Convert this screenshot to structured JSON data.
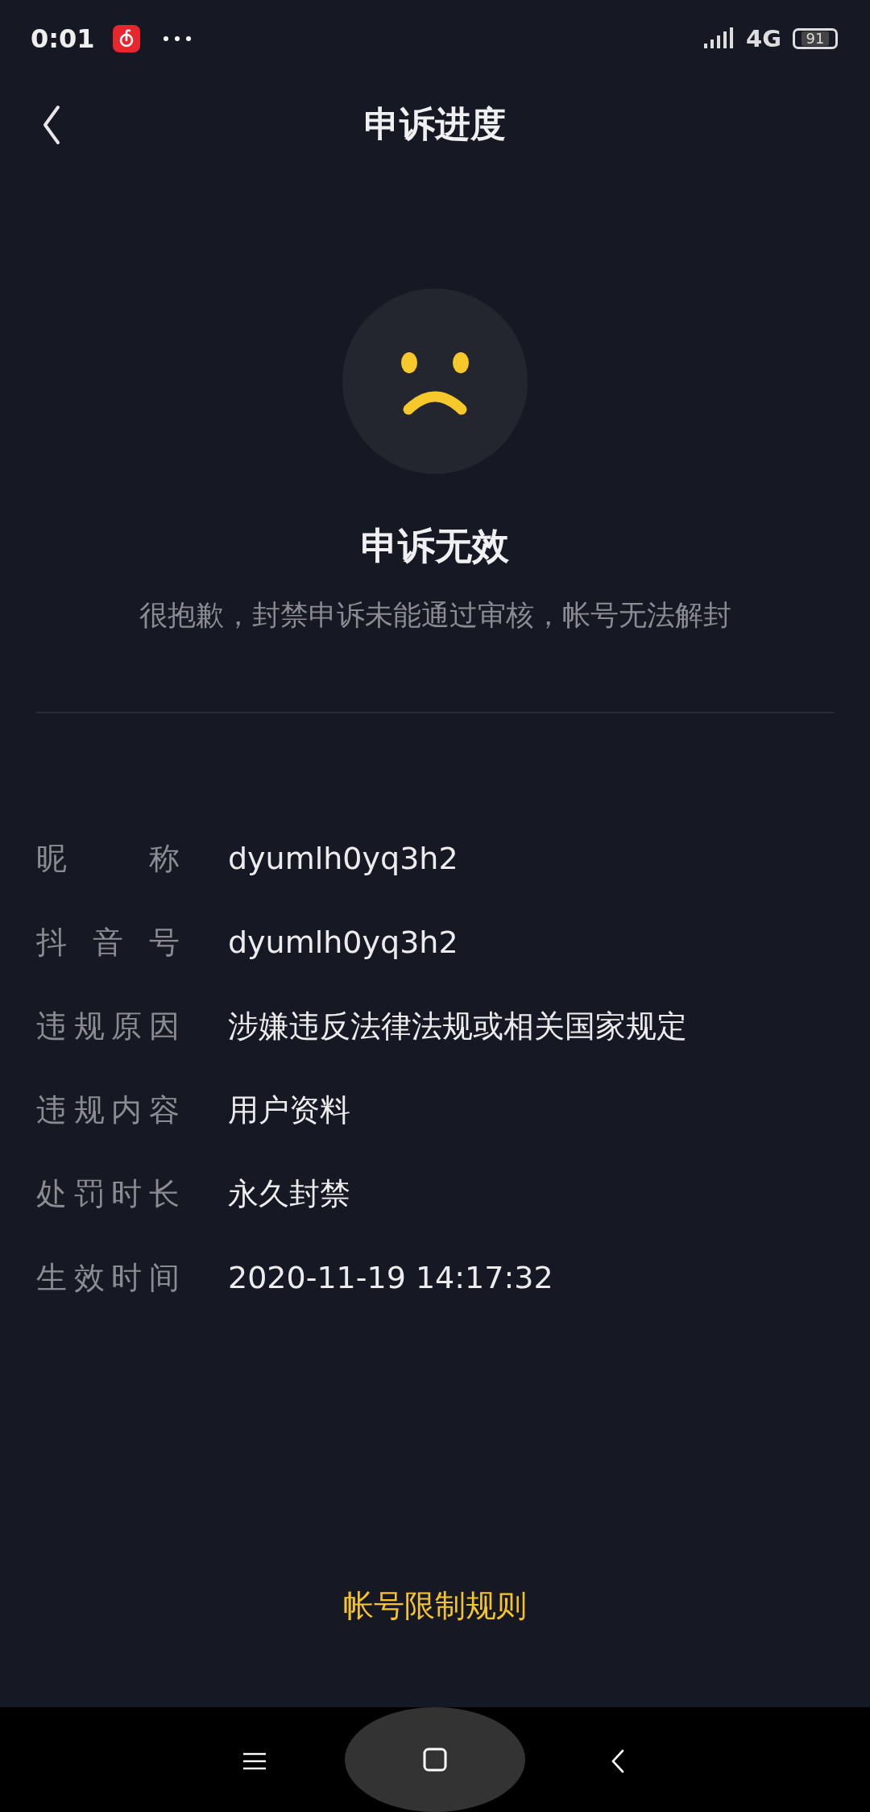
{
  "status_bar": {
    "time": "0:01",
    "network": "4G",
    "battery": "91"
  },
  "header": {
    "title": "申诉进度"
  },
  "result": {
    "title": "申诉无效",
    "message": "很抱歉，封禁申诉未能通过审核，帐号无法解封"
  },
  "details": [
    {
      "label": "昵称",
      "value": "dyumlh0yq3h2"
    },
    {
      "label": "抖音号",
      "value": "dyumlh0yq3h2"
    },
    {
      "label": "违规原因",
      "value": "涉嫌违反法律法规或相关国家规定"
    },
    {
      "label": "违规内容",
      "value": "用户资料"
    },
    {
      "label": "处罚时长",
      "value": "永久封禁"
    },
    {
      "label": "生效时间",
      "value": "2020-11-19 14:17:32"
    }
  ],
  "footer_link": "帐号限制规则"
}
